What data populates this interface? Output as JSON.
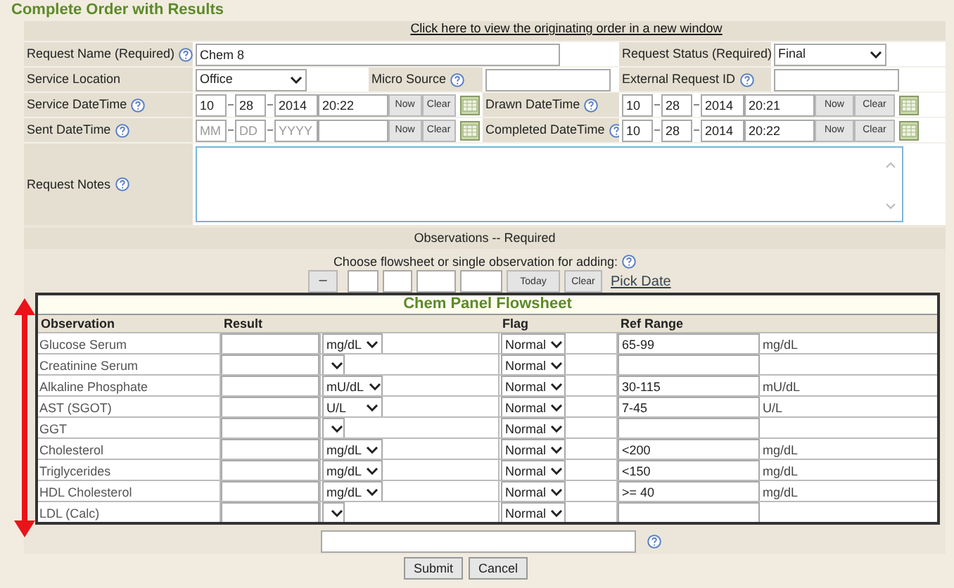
{
  "title": "Complete Order with Results",
  "order_link": "Click here to view the originating order in a new window",
  "request_name": {
    "label": "Request Name (Required)",
    "help": true,
    "value": "Chem 8"
  },
  "request_status": {
    "label": "Request Status (Required)",
    "help": false,
    "value": "Final"
  },
  "service_location": {
    "label": "Service Location",
    "help": false,
    "value": "Office"
  },
  "micro_source": {
    "label": "Micro Source",
    "help": true
  },
  "external_request_id": {
    "label": "External Request ID",
    "help": true
  },
  "service_datetime": {
    "label": "Service DateTime",
    "help": true,
    "month": "10",
    "day": "28",
    "year": "2014",
    "time": "20:22",
    "now_button": "Now",
    "clear_button": "Clear"
  },
  "drawn_datetime": {
    "label": "Drawn DateTime",
    "help": true,
    "month": "10",
    "day": "28",
    "year": "2014",
    "time": "20:21",
    "now_button": "Now",
    "clear_button": "Clear"
  },
  "sent_datetime": {
    "label": "Sent DateTime",
    "help": true,
    "month_placeholder": "MM",
    "day_placeholder": "DD",
    "year_placeholder": "YYYY",
    "now_button": "Now",
    "clear_button": "Clear"
  },
  "completed_datetime": {
    "label": "Completed DateTime",
    "help": true,
    "month": "10",
    "day": "28",
    "year": "2014",
    "time": "20:22",
    "now_button": "Now",
    "clear_button": "Clear"
  },
  "request_notes": {
    "label": "Request Notes",
    "help": true
  },
  "observations": {
    "heading": "Observations -- Required",
    "choose_label": "Choose flowsheet or single observation for adding:",
    "minus_button": "–",
    "today_button": "Today",
    "clear_button": "Clear",
    "pick_date": "Pick Date"
  },
  "flowsheet": {
    "title": "Chem Panel Flowsheet",
    "columns": [
      "Observation",
      "Result",
      "Flag",
      "Ref Range"
    ],
    "rows": [
      {
        "name": "Glucose Serum",
        "unit": "mg/dL",
        "flag": "Normal",
        "ref_range": "65-99",
        "ref_unit": "mg/dL"
      },
      {
        "name": "Creatinine Serum",
        "flag": "Normal"
      },
      {
        "name": "Alkaline Phosphate",
        "unit": "mU/dL",
        "flag": "Normal",
        "ref_range": "30-115",
        "ref_unit": "mU/dL"
      },
      {
        "name": "AST (SGOT)",
        "unit": "U/L",
        "flag": "Normal",
        "ref_range": "7-45",
        "ref_unit": "U/L"
      },
      {
        "name": "GGT",
        "flag": "Normal"
      },
      {
        "name": "Cholesterol",
        "unit": "mg/dL",
        "flag": "Normal",
        "ref_range": "<200",
        "ref_unit": "mg/dL"
      },
      {
        "name": "Triglycerides",
        "unit": "mg/dL",
        "flag": "Normal",
        "ref_range": "<150",
        "ref_unit": "mg/dL"
      },
      {
        "name": "HDL Cholesterol",
        "unit": "mg/dL",
        "flag": "Normal",
        "ref_range": ">= 40",
        "ref_unit": "mg/dL"
      },
      {
        "name": "LDL (Calc)",
        "flag": "Normal"
      }
    ]
  },
  "buttons": [
    "Submit",
    "Cancel"
  ]
}
